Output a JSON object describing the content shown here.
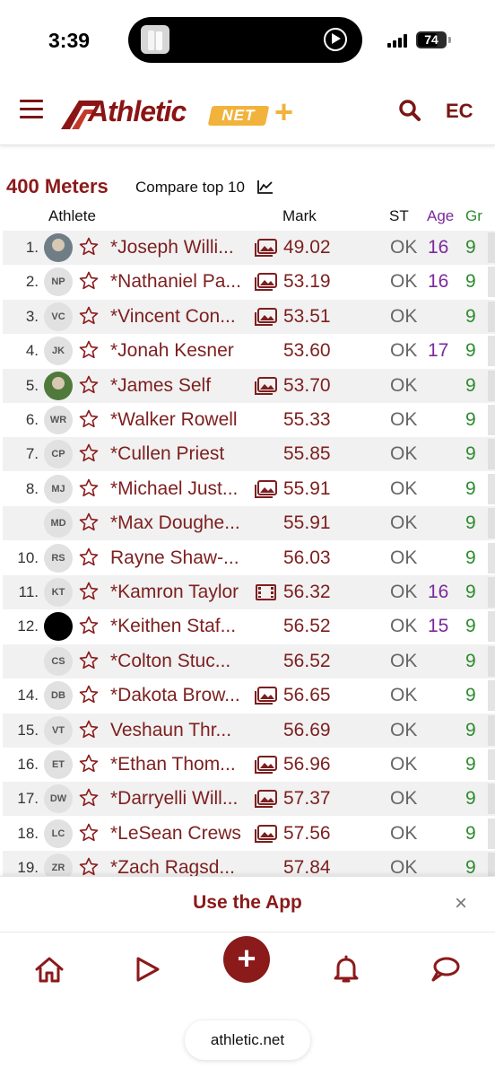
{
  "status_bar": {
    "time": "3:39",
    "battery": "74"
  },
  "header": {
    "logo_text": "Athletic",
    "logo_net": "NET",
    "profile_initials": "EC",
    "brand_color": "#8b1a1a"
  },
  "section": {
    "title": "400 Meters",
    "compare_label": "Compare top 10"
  },
  "table": {
    "headers": {
      "athlete": "Athlete",
      "mark": "Mark",
      "st": "ST",
      "age": "Age",
      "gr": "Gr"
    },
    "rows": [
      {
        "rank": "1.",
        "initials": "",
        "name": "*Joseph Willi...",
        "mark": "49.02",
        "st": "OK",
        "age": "16",
        "gr": "9"
      },
      {
        "rank": "2.",
        "initials": "NP",
        "name": "*Nathaniel Pa...",
        "mark": "53.19",
        "st": "OK",
        "age": "16",
        "gr": "9"
      },
      {
        "rank": "3.",
        "initials": "VC",
        "name": "*Vincent Con...",
        "mark": "53.51",
        "st": "OK",
        "age": "",
        "gr": "9"
      },
      {
        "rank": "4.",
        "initials": "JK",
        "name": "*Jonah Kesner",
        "mark": "53.60",
        "st": "OK",
        "age": "17",
        "gr": "9"
      },
      {
        "rank": "5.",
        "initials": "",
        "name": "*James Self",
        "mark": "53.70",
        "st": "OK",
        "age": "",
        "gr": "9"
      },
      {
        "rank": "6.",
        "initials": "WR",
        "name": "*Walker Rowell",
        "mark": "55.33",
        "st": "OK",
        "age": "",
        "gr": "9"
      },
      {
        "rank": "7.",
        "initials": "CP",
        "name": "*Cullen Priest",
        "mark": "55.85",
        "st": "OK",
        "age": "",
        "gr": "9"
      },
      {
        "rank": "8.",
        "initials": "MJ",
        "name": "*Michael Just...",
        "mark": "55.91",
        "st": "OK",
        "age": "",
        "gr": "9"
      },
      {
        "rank": "",
        "initials": "MD",
        "name": "*Max Doughe...",
        "mark": "55.91",
        "st": "OK",
        "age": "",
        "gr": "9"
      },
      {
        "rank": "10.",
        "initials": "RS",
        "name": "Rayne Shaw-...",
        "mark": "56.03",
        "st": "OK",
        "age": "",
        "gr": "9"
      },
      {
        "rank": "11.",
        "initials": "KT",
        "name": "*Kamron Taylor",
        "mark": "56.32",
        "st": "OK",
        "age": "16",
        "gr": "9"
      },
      {
        "rank": "12.",
        "initials": "",
        "name": "*Keithen Staf...",
        "mark": "56.52",
        "st": "OK",
        "age": "15",
        "gr": "9"
      },
      {
        "rank": "",
        "initials": "CS",
        "name": "*Colton Stuc...",
        "mark": "56.52",
        "st": "OK",
        "age": "",
        "gr": "9"
      },
      {
        "rank": "14.",
        "initials": "DB",
        "name": "*Dakota Brow...",
        "mark": "56.65",
        "st": "OK",
        "age": "",
        "gr": "9"
      },
      {
        "rank": "15.",
        "initials": "VT",
        "name": "Veshaun Thr...",
        "mark": "56.69",
        "st": "OK",
        "age": "",
        "gr": "9"
      },
      {
        "rank": "16.",
        "initials": "ET",
        "name": "*Ethan Thom...",
        "mark": "56.96",
        "st": "OK",
        "age": "",
        "gr": "9"
      },
      {
        "rank": "17.",
        "initials": "DW",
        "name": "*Darryelli Will...",
        "mark": "57.37",
        "st": "OK",
        "age": "",
        "gr": "9"
      },
      {
        "rank": "18.",
        "initials": "LC",
        "name": "*LeSean Crews",
        "mark": "57.56",
        "st": "OK",
        "age": "",
        "gr": "9"
      },
      {
        "rank": "19.",
        "initials": "ZR",
        "name": "*Zach Ragsd...",
        "mark": "57.84",
        "st": "OK",
        "age": "",
        "gr": "9"
      }
    ]
  },
  "banner": {
    "text": "Use the App",
    "close": "×"
  },
  "tab_bar": {
    "add": "+"
  },
  "browser": {
    "url": "athletic.net"
  }
}
